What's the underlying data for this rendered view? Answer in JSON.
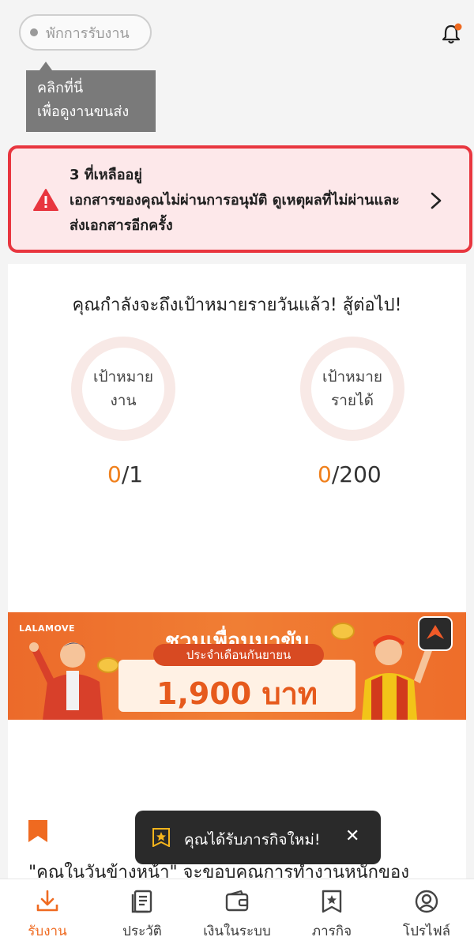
{
  "status": {
    "label": "พักการรับงาน"
  },
  "tooltip": {
    "line1": "คลิกที่นี่",
    "line2": "เพื่อดูงานขนส่ง"
  },
  "alert": {
    "title": "3 ที่เหลืออยู่",
    "body": "เอกสารของคุณไม่ผ่านการอนุมัติ ดูเหตุผลที่ไม่ผ่านและส่งเอกสารอีกครั้ง",
    "accent": "#e8363f"
  },
  "goals": {
    "heading": "คุณกำลังจะถึงเป้าหมายรายวันแล้ว! สู้ต่อไป!",
    "items": [
      {
        "label_line1": "เป้าหมาย",
        "label_line2": "งาน",
        "current": "0",
        "target": "/1"
      },
      {
        "label_line1": "เป้าหมาย",
        "label_line2": "รายได้",
        "current": "0",
        "target": "/200"
      }
    ]
  },
  "banner": {
    "brand": "LALAMOVE",
    "title": "ชวนเพื่อนมาขับ",
    "subtitle": "ประจำเดือนกันยายน",
    "amount": "1,900 บาท"
  },
  "quote": {
    "text": "\"คุณในวันข้างหน้า\" จะขอบคุณการทำงานหนักของ"
  },
  "toast": {
    "text": "คุณได้รับภารกิจใหม่!",
    "close": "✕"
  },
  "tabs": [
    {
      "label": "รับงาน",
      "icon": "download-icon",
      "active": true
    },
    {
      "label": "ประวัติ",
      "icon": "history-icon",
      "active": false
    },
    {
      "label": "เงินในระบบ",
      "icon": "wallet-icon",
      "active": false
    },
    {
      "label": "ภารกิจ",
      "icon": "mission-icon",
      "active": false
    },
    {
      "label": "โปรไฟล์",
      "icon": "profile-icon",
      "active": false
    }
  ],
  "colors": {
    "brand": "#ef6a20",
    "alert_bg": "#fde8ea",
    "toast_bg": "#2a2a2a"
  }
}
